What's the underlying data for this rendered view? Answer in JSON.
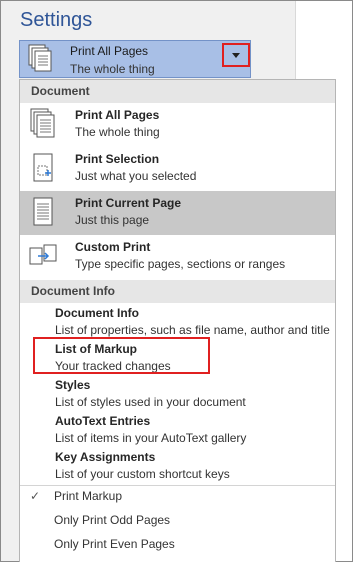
{
  "settings_title": "Settings",
  "dropdown": {
    "title": "Print All Pages",
    "subtitle": "The whole thing"
  },
  "sections": {
    "document": "Document",
    "document_info": "Document Info"
  },
  "document_items": [
    {
      "title": "Print All Pages",
      "subtitle": "The whole thing",
      "icon": "print-all-pages-icon"
    },
    {
      "title": "Print Selection",
      "subtitle": "Just what you selected",
      "icon": "print-selection-icon"
    },
    {
      "title": "Print Current Page",
      "subtitle": "Just this page",
      "icon": "print-current-page-icon",
      "selected": true
    },
    {
      "title": "Custom Print",
      "subtitle": "Type specific pages, sections or ranges",
      "icon": "custom-print-icon"
    }
  ],
  "info_items": [
    {
      "title": "Document Info",
      "subtitle": "List of properties, such as file name, author and title"
    },
    {
      "title": "List of Markup",
      "subtitle": "Your tracked changes"
    },
    {
      "title": "Styles",
      "subtitle": "List of styles used in your document"
    },
    {
      "title": "AutoText Entries",
      "subtitle": "List of items in your AutoText gallery"
    },
    {
      "title": "Key Assignments",
      "subtitle": "List of your custom shortcut keys"
    }
  ],
  "options": [
    {
      "label": "Print Markup",
      "checked": true,
      "check_mark": "✓"
    },
    {
      "label": "Only Print Odd Pages",
      "checked": false
    },
    {
      "label": "Only Print Even Pages",
      "checked": false
    }
  ],
  "colors": {
    "accent": "#2f5597",
    "highlight_red": "#e02020",
    "dropdown_bg": "#a8bfe6",
    "selected_bg": "#c8c8c8"
  }
}
